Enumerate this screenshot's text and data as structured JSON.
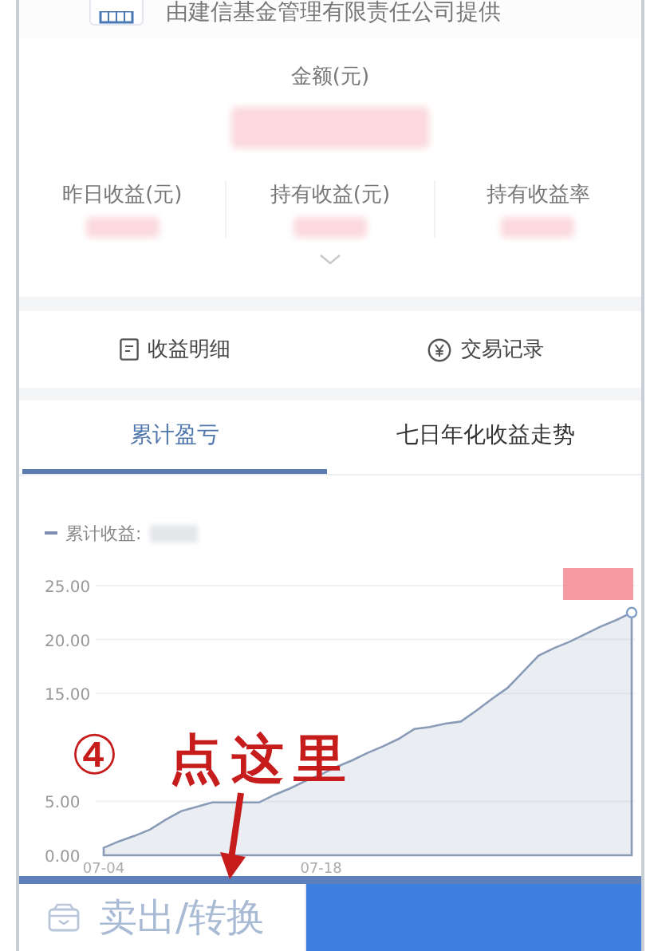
{
  "provider": {
    "text": "由建信基金管理有限责任公司提供"
  },
  "amount": {
    "label": "金额(元)",
    "value_hidden": true
  },
  "metrics": [
    {
      "label": "昨日收益(元)",
      "value_hidden": true
    },
    {
      "label": "持有收益(元)",
      "value_hidden": true
    },
    {
      "label": "持有收益率",
      "value_hidden": true
    }
  ],
  "actions": [
    {
      "label": "收益明细",
      "kind": "document"
    },
    {
      "label": "交易记录",
      "kind": "coin"
    }
  ],
  "tabs": [
    {
      "label": "累计盈亏",
      "selected": true
    },
    {
      "label": "七日年化收益走势",
      "selected": false
    }
  ],
  "chart": {
    "legend": "累计收益:",
    "legend_value_hidden": true,
    "tooltip_value_hidden": true,
    "chart_data": {
      "type": "area",
      "grid": true,
      "categories": [
        "07-04",
        null,
        null,
        null,
        null,
        null,
        null,
        null,
        null,
        null,
        null,
        null,
        null,
        null,
        "07-18",
        null,
        null,
        null,
        null,
        null,
        null,
        null,
        null,
        null,
        null,
        null,
        null,
        null,
        null,
        null,
        null,
        null,
        null,
        null,
        null
      ],
      "series": [
        {
          "color": "#8a9bb8",
          "values": [
            0.7,
            1.3,
            1.8,
            2.4,
            3.3,
            4.1,
            4.5,
            4.9,
            4.9,
            4.9,
            4.9,
            5.6,
            6.2,
            6.9,
            7.5,
            8.2,
            8.8,
            9.5,
            10.1,
            10.8,
            11.7,
            11.9,
            12.2,
            12.4,
            13.4,
            14.5,
            15.5,
            17.0,
            18.5,
            19.2,
            19.8,
            20.5,
            21.2,
            21.8,
            22.5
          ]
        }
      ],
      "ylim": [
        0,
        25
      ],
      "yticks": [
        {
          "value": 0,
          "label": "0.00"
        },
        {
          "value": 5,
          "label": "5.00"
        },
        {
          "value": 15,
          "label": "15.00"
        },
        {
          "value": 20,
          "label": "20.00"
        },
        {
          "value": 25,
          "label": "25.00"
        }
      ]
    }
  },
  "bottom_bar": {
    "sell_button": "卖出/转换"
  },
  "annotation": {
    "number": "④",
    "text": "点这里"
  }
}
